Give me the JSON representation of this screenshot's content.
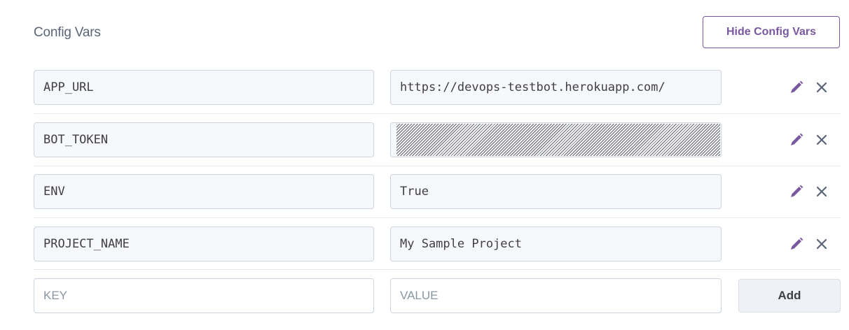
{
  "header": {
    "title": "Config Vars",
    "hide_button_label": "Hide Config Vars"
  },
  "vars": [
    {
      "key": "APP_URL",
      "value": "https://devops-testbot.herokuapp.com/",
      "masked": false
    },
    {
      "key": "BOT_TOKEN",
      "value": "",
      "masked": true
    },
    {
      "key": "ENV",
      "value": "True",
      "masked": false
    },
    {
      "key": "PROJECT_NAME",
      "value": "My Sample Project",
      "masked": false
    }
  ],
  "new_var": {
    "key_placeholder": "KEY",
    "value_placeholder": "VALUE",
    "add_label": "Add"
  },
  "icons": {
    "edit": "pencil-icon",
    "delete": "close-icon"
  },
  "colors": {
    "accent": "#79589f",
    "delete": "#5a6577"
  }
}
